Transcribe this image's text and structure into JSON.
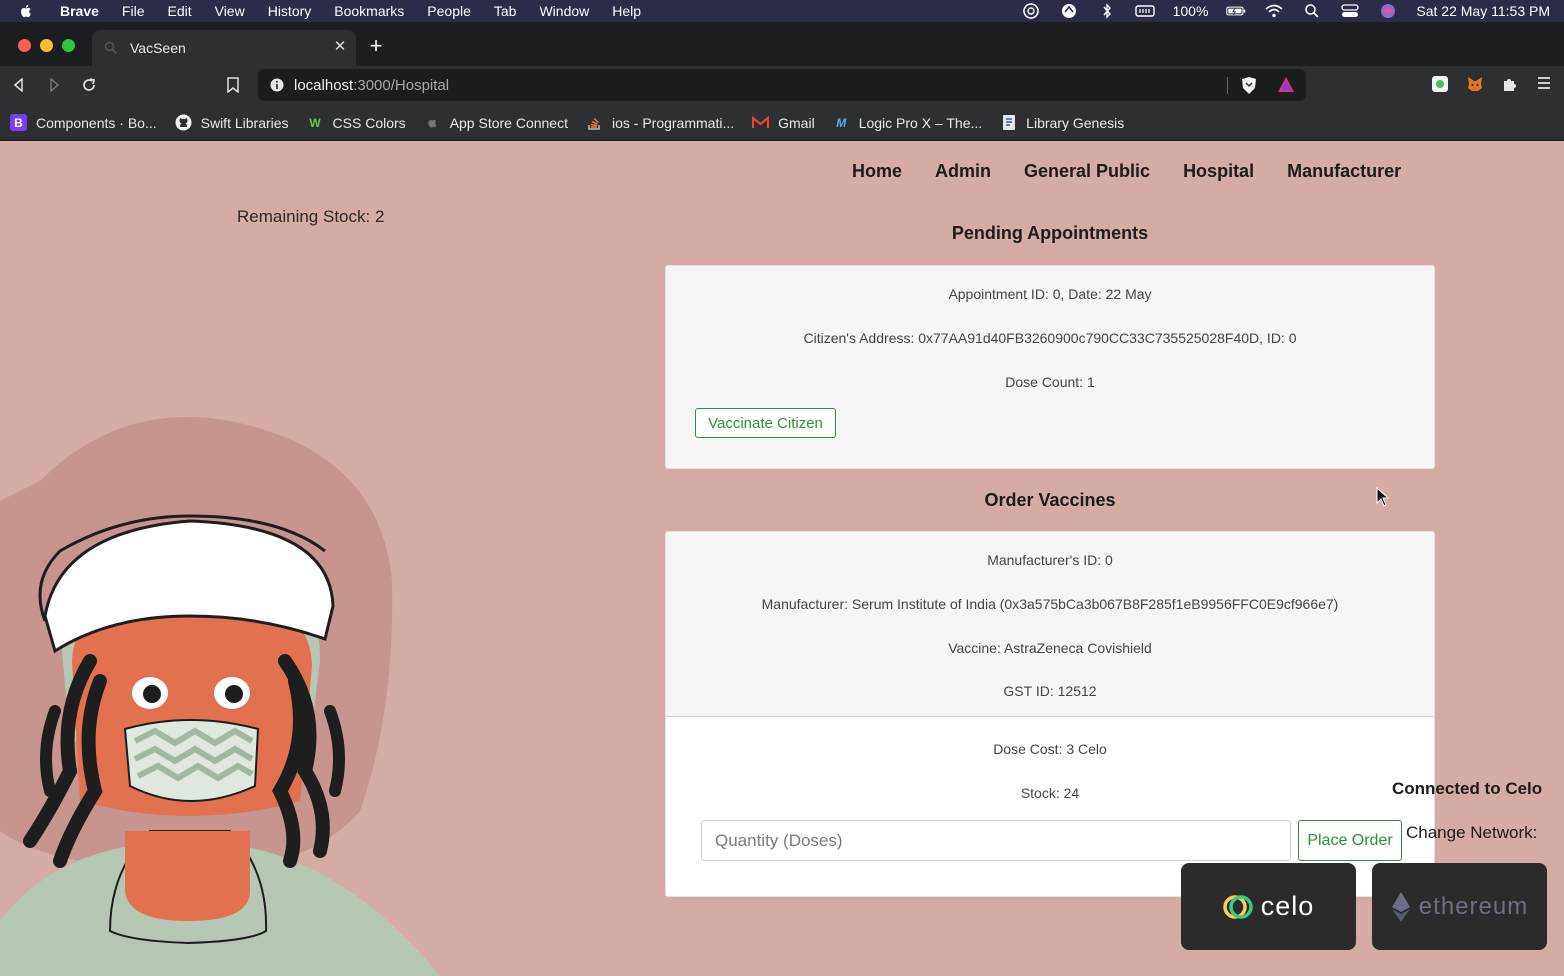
{
  "menubar": {
    "app": "Brave",
    "items": [
      "File",
      "Edit",
      "View",
      "History",
      "Bookmarks",
      "People",
      "Tab",
      "Window",
      "Help"
    ],
    "battery": "100%",
    "datetime": "Sat 22 May  11:53 PM"
  },
  "tab": {
    "title": "VacSeen"
  },
  "address": {
    "host": "localhost",
    "path": ":3000/Hospital"
  },
  "bookmarks": [
    {
      "label": "Components · Bo...",
      "icon": "B"
    },
    {
      "label": "Swift Libraries",
      "icon": "github"
    },
    {
      "label": "CSS Colors",
      "icon": "W"
    },
    {
      "label": "App Store Connect",
      "icon": "apple"
    },
    {
      "label": "ios - Programmati...",
      "icon": "stackoverflow"
    },
    {
      "label": "Gmail",
      "icon": "M"
    },
    {
      "label": "Logic Pro X – The...",
      "icon": "M"
    },
    {
      "label": "Library Genesis",
      "icon": "book"
    }
  ],
  "nav": {
    "home": "Home",
    "admin": "Admin",
    "public": "General Public",
    "hospital": "Hospital",
    "manufacturer": "Manufacturer"
  },
  "remaining_stock": "Remaining Stock: 2",
  "pending": {
    "title": "Pending Appointments",
    "appointment": "Appointment ID: 0, Date: 22 May",
    "citizen": "Citizen's Address: 0x77AA91d40FB3260900c790CC33C735525028F40D, ID: 0",
    "dose_count": "Dose Count: 1",
    "vaccinate_label": "Vaccinate Citizen"
  },
  "order": {
    "title": "Order Vaccines",
    "manufacturer_id": "Manufacturer's ID: 0",
    "manufacturer": "Manufacturer: Serum Institute of India (0x3a575bCa3b067B8F285f1eB9956FFC0E9cf966e7)",
    "vaccine": "Vaccine: AstraZeneca Covishield",
    "gst": "GST ID: 12512",
    "dose_cost": "Dose Cost: 3 Celo",
    "stock": "Stock: 24",
    "qty_placeholder": "Quantity (Doses)",
    "place_order_label": "Place Order"
  },
  "network": {
    "connected": "Connected to Celo",
    "change": "Change Network:",
    "celo_label": "celo",
    "ethereum_label": "ethereum"
  },
  "colors": {
    "page_bg": "#d4aca5",
    "accent_green": "#2f8f3a",
    "menubar_bg": "#2a2c48"
  }
}
